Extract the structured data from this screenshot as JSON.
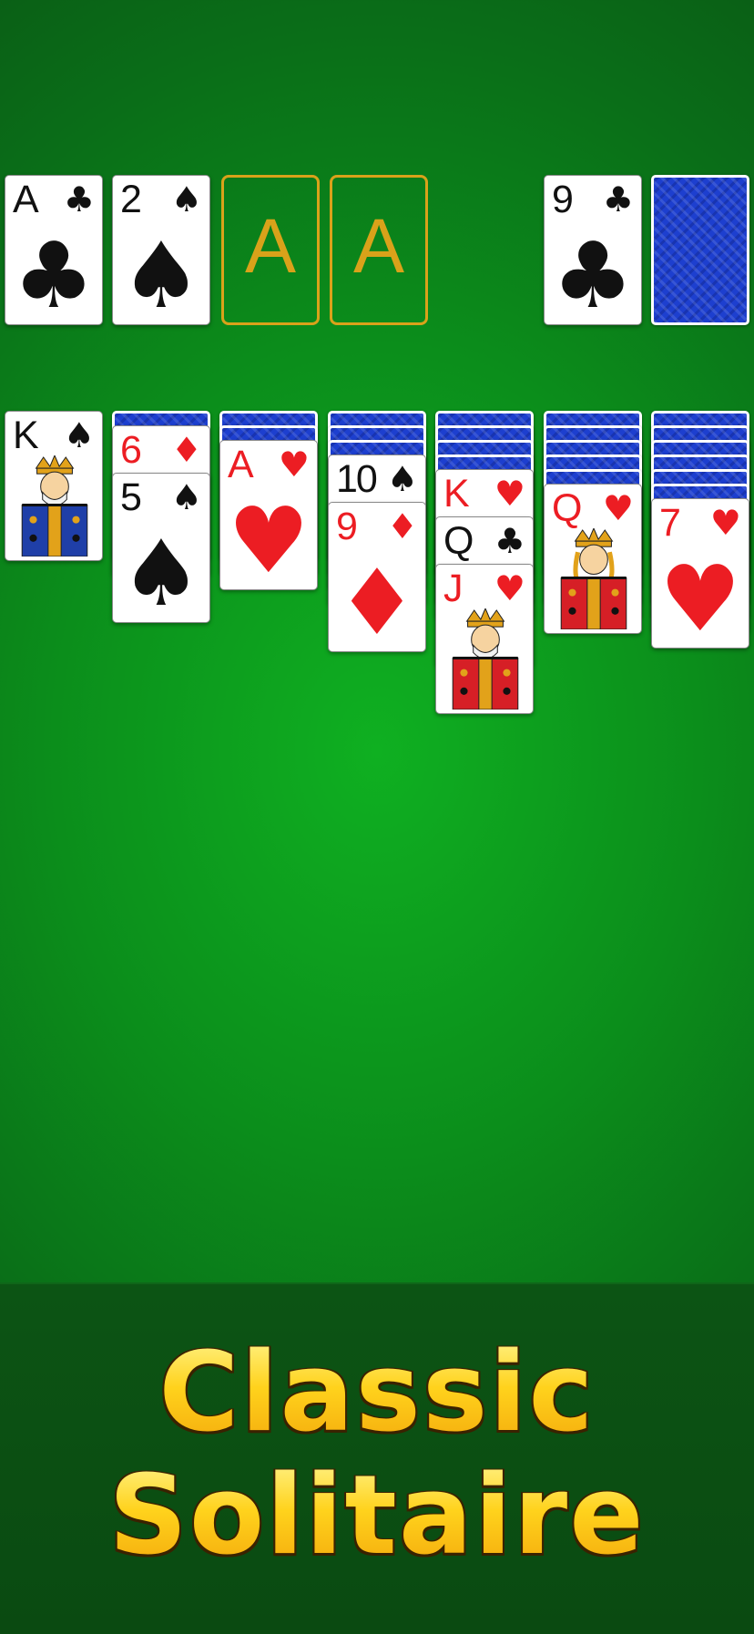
{
  "foundations": [
    {
      "rank": "A",
      "suit": "♣",
      "color": "black"
    },
    {
      "rank": "2",
      "suit": "♠",
      "color": "black"
    },
    {
      "empty_label": "A"
    },
    {
      "empty_label": "A"
    }
  ],
  "waste": {
    "rank": "9",
    "suit": "♣",
    "color": "black"
  },
  "stock": {
    "face_down": true
  },
  "tableau": [
    {
      "hidden": 0,
      "cards": [
        {
          "rank": "K",
          "suit": "♠",
          "color": "black",
          "face": "king"
        }
      ]
    },
    {
      "hidden": 1,
      "cards": [
        {
          "rank": "6",
          "suit": "♦",
          "color": "red"
        },
        {
          "rank": "5",
          "suit": "♠",
          "color": "black"
        }
      ]
    },
    {
      "hidden": 2,
      "cards": [
        {
          "rank": "A",
          "suit": "♥",
          "color": "red"
        }
      ]
    },
    {
      "hidden": 3,
      "cards": [
        {
          "rank": "10",
          "suit": "♠",
          "color": "black"
        },
        {
          "rank": "9",
          "suit": "♦",
          "color": "red"
        }
      ]
    },
    {
      "hidden": 4,
      "cards": [
        {
          "rank": "K",
          "suit": "♥",
          "color": "red"
        },
        {
          "rank": "Q",
          "suit": "♣",
          "color": "black"
        },
        {
          "rank": "J",
          "suit": "♥",
          "color": "red",
          "face": "jack"
        }
      ]
    },
    {
      "hidden": 5,
      "cards": [
        {
          "rank": "Q",
          "suit": "♥",
          "color": "red",
          "face": "queen"
        }
      ]
    },
    {
      "hidden": 6,
      "cards": [
        {
          "rank": "7",
          "suit": "♥",
          "color": "red"
        }
      ]
    }
  ],
  "banner": {
    "line1": "Classic",
    "line2": "Solitaire"
  },
  "colors": {
    "felt": "#0b8e1b",
    "slot_gold": "#d9a21a",
    "card_back": "#1d3fcf",
    "red_suit": "#ec1d23"
  }
}
